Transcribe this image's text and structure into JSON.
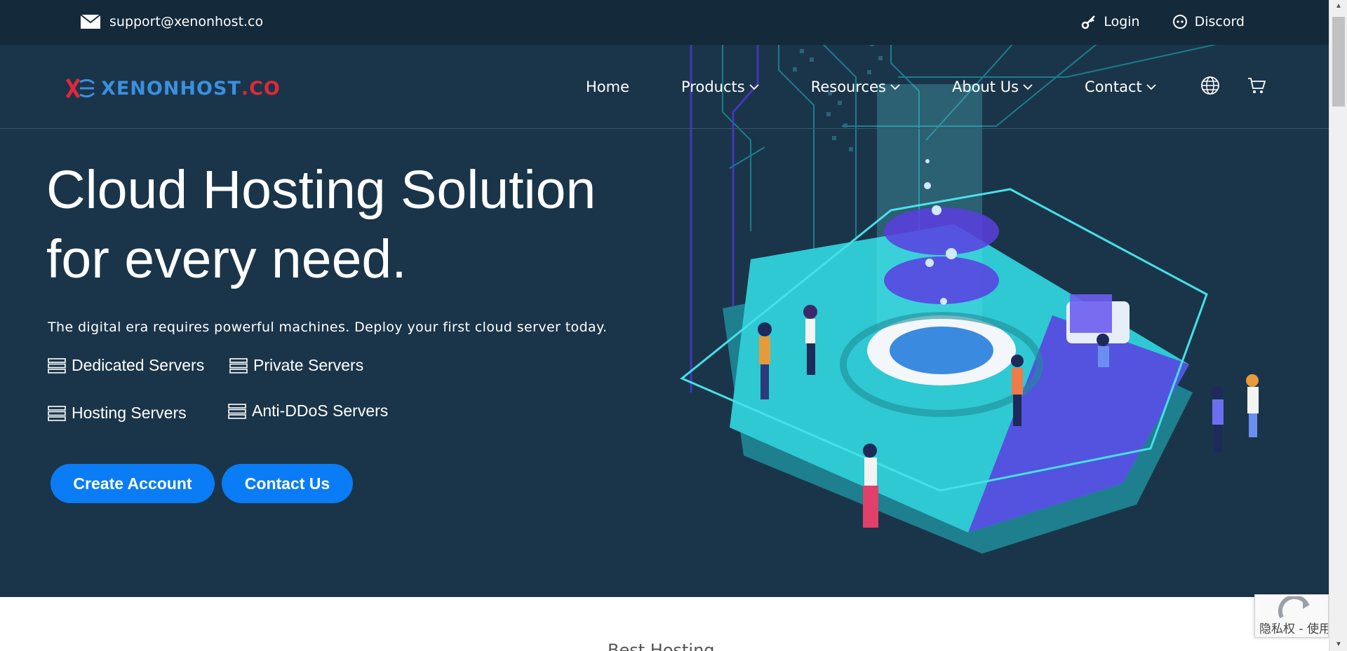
{
  "topbar": {
    "email": "support@xenonhost.co",
    "login": "Login",
    "discord": "Discord"
  },
  "brand": {
    "prefix": "XENONHOST",
    "suffix": ".CO"
  },
  "nav": {
    "home": "Home",
    "products": "Products",
    "resources": "Resources",
    "about": "About Us",
    "contact": "Contact"
  },
  "hero": {
    "headline_line1": "Cloud Hosting Solution",
    "headline_line2": "for every need.",
    "subtitle": "The digital era requires powerful machines. Deploy your first cloud server today.",
    "features": [
      "Dedicated Servers",
      "Private Servers",
      "Hosting Servers",
      "Anti-DDoS Servers"
    ],
    "cta_primary": "Create Account",
    "cta_secondary": "Contact Us"
  },
  "below": {
    "peek_heading": "Best Hosting"
  },
  "recaptcha": {
    "text": "隐私权 - 使用条款"
  },
  "colors": {
    "hero_bg": "#1a3549",
    "topbar_bg": "#14293a",
    "button": "#0a7cf5",
    "brand_blue": "#3b8fe0",
    "brand_red": "#e0283a",
    "platform_teal": "#2ec9d3",
    "platform_violet": "#5b3ee0"
  },
  "icons": {
    "email": "envelope-icon",
    "login": "key-icon",
    "discord": "discord-icon",
    "language": "globe-icon",
    "cart": "cart-icon",
    "feature": "server-icon",
    "dropdown": "chevron-down-icon"
  }
}
